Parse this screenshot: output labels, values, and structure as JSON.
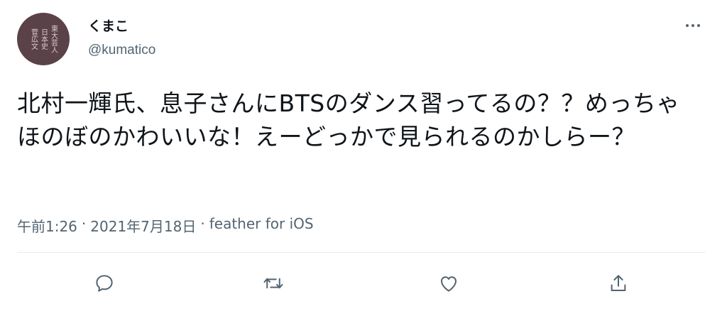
{
  "user": {
    "display_name": "くまこ",
    "handle": "@kumatico",
    "avatar_columns": [
      "東大芸人",
      "日本史",
      "菅広文"
    ]
  },
  "tweet": {
    "text": "北村一輝氏、息子さんにBTSのダンス習ってるの？？めっちゃほのぼのかわいいな！えーどっかで見られるのかしらー？"
  },
  "meta": {
    "time": "午前1:26",
    "separator1": "·",
    "date": "2021年7月18日",
    "separator2": "·",
    "source": "feather for iOS"
  },
  "actions": [
    "reply-icon",
    "retweet-icon",
    "like-icon",
    "share-icon"
  ],
  "colors": {
    "text": "#0f1419",
    "secondary": "#536471",
    "divider": "#e6ecf0",
    "avatar": "#5a4248"
  }
}
